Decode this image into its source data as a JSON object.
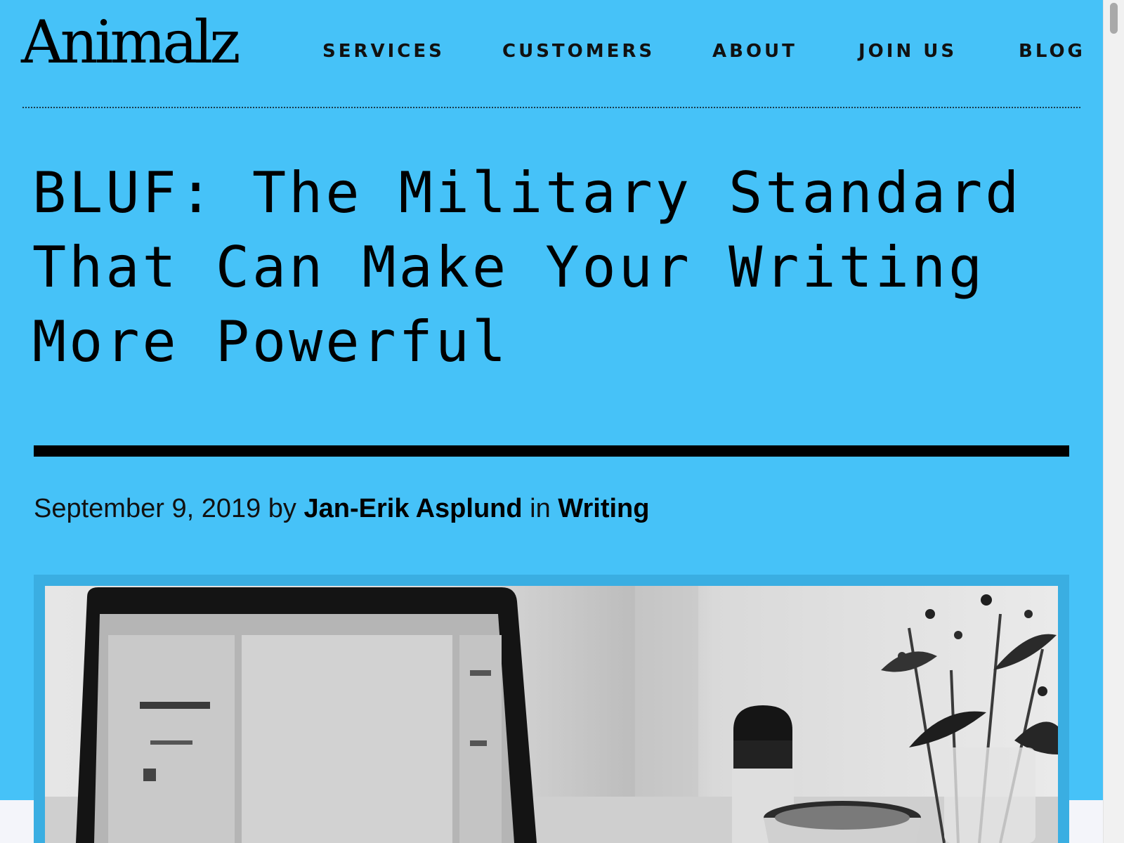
{
  "brand": {
    "logo_text": "Animalz",
    "background_color": "#46c2f8",
    "text_color": "#000000"
  },
  "nav": {
    "items": [
      {
        "label": "SERVICES"
      },
      {
        "label": "CUSTOMERS"
      },
      {
        "label": "ABOUT"
      },
      {
        "label": "JOIN US"
      },
      {
        "label": "BLOG"
      }
    ]
  },
  "article": {
    "title": "BLUF: The Military Standard That Can Make Your Writing More Powerful",
    "date": "September 9, 2019",
    "by_word": "by",
    "author": "Jan-Erik Asplund",
    "in_word": "in",
    "category": "Writing",
    "hero_image": {
      "icon": "laptop-desk-photo",
      "style": "black-and-white"
    }
  }
}
